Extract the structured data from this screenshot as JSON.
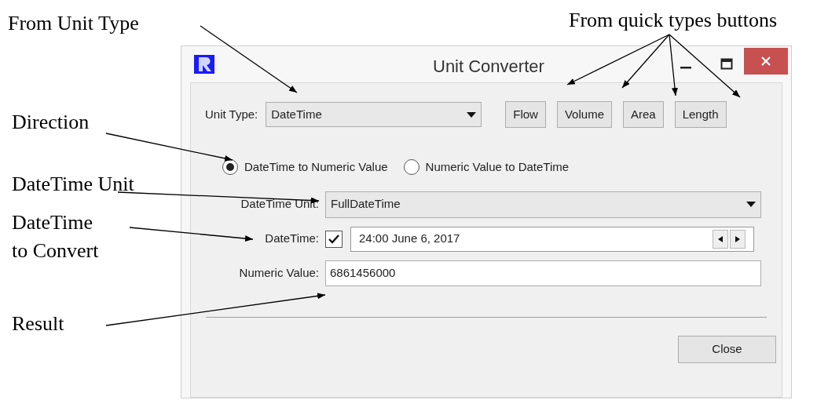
{
  "annotations": [
    {
      "lines": [
        "From Unit Type"
      ]
    },
    {
      "lines": [
        "From quick types buttons"
      ]
    },
    {
      "lines": [
        "Direction"
      ]
    },
    {
      "lines": [
        "DateTime Unit"
      ]
    },
    {
      "lines": [
        "DateTime",
        "to Convert"
      ]
    },
    {
      "lines": [
        "Result"
      ]
    }
  ],
  "window": {
    "title": "Unit Converter"
  },
  "unit_type": {
    "label": "Unit Type:",
    "value": "DateTime"
  },
  "quick_buttons": [
    "Flow",
    "Volume",
    "Area",
    "Length"
  ],
  "direction": [
    {
      "label": "DateTime to Numeric Value",
      "selected": true
    },
    {
      "label": "Numeric Value to DateTime",
      "selected": false
    }
  ],
  "datetime_unit": {
    "label": "DateTime Unit:",
    "value": "FullDateTime"
  },
  "datetime": {
    "label": "DateTime:",
    "checked": true,
    "value": "24:00 June 6, 2017"
  },
  "numeric_value": {
    "label": "Numeric Value:",
    "value": "6861456000"
  },
  "close_button": "Close"
}
